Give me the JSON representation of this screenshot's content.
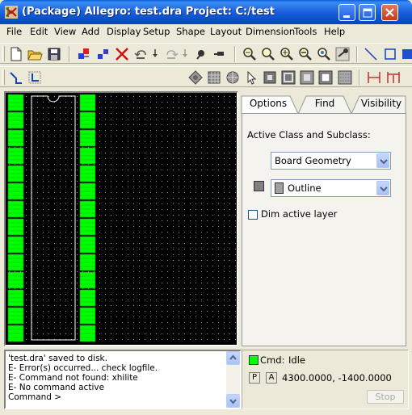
{
  "window": {
    "title": "(Package) Allegro: test.dra  Project: C:/test"
  },
  "menu": [
    "File",
    "Edit",
    "View",
    "Add",
    "Display",
    "Setup",
    "Shape",
    "Layout",
    "Dimension",
    "Tools",
    "Help"
  ],
  "toolbar": {
    "row1": [
      "new",
      "open",
      "save",
      "move",
      "copy",
      "delete",
      "undo",
      "undo-arrow",
      "redo",
      "redo-arrow",
      "fix",
      "unfix",
      "zoom-points",
      "zoom-fit",
      "zoom-in",
      "zoom-out",
      "zoom-world",
      "zoom-previous",
      "add-line",
      "add-rectangle"
    ],
    "row2": [
      "add-connect",
      "add-pin",
      "place-symbol",
      "grid",
      "circle-select",
      "pointer",
      "place-pin",
      "select-box",
      "window-select",
      "rectangle-select",
      "raster",
      "dimension-linear",
      "dimension-datum"
    ]
  },
  "panel": {
    "tabs": [
      "Options",
      "Find",
      "Visibility"
    ],
    "active_tab": "Options",
    "section_label": "Active Class and Subclass:",
    "class_value": "Board Geometry",
    "subclass_value": "Outline",
    "subclass_color": "#808080",
    "dim_active_label": "Dim active layer",
    "dim_active_checked": false
  },
  "console": {
    "lines": [
      "'test.dra' saved to disk.",
      "E- Error(s) occurred... check logfile.",
      "E- Command not found: xhilite",
      "E- No command active",
      "Command >"
    ]
  },
  "status": {
    "cmd_label": "Cmd:",
    "cmd_value": "Idle",
    "cmd_color": "#00ff00",
    "p_label": "P",
    "a_label": "A",
    "coordinates": "4300.0000, -1400.0000",
    "stop_label": "Stop"
  },
  "colors": {
    "pad": "#00ff00",
    "outline": "#ffffff",
    "canvas": "#000000"
  }
}
